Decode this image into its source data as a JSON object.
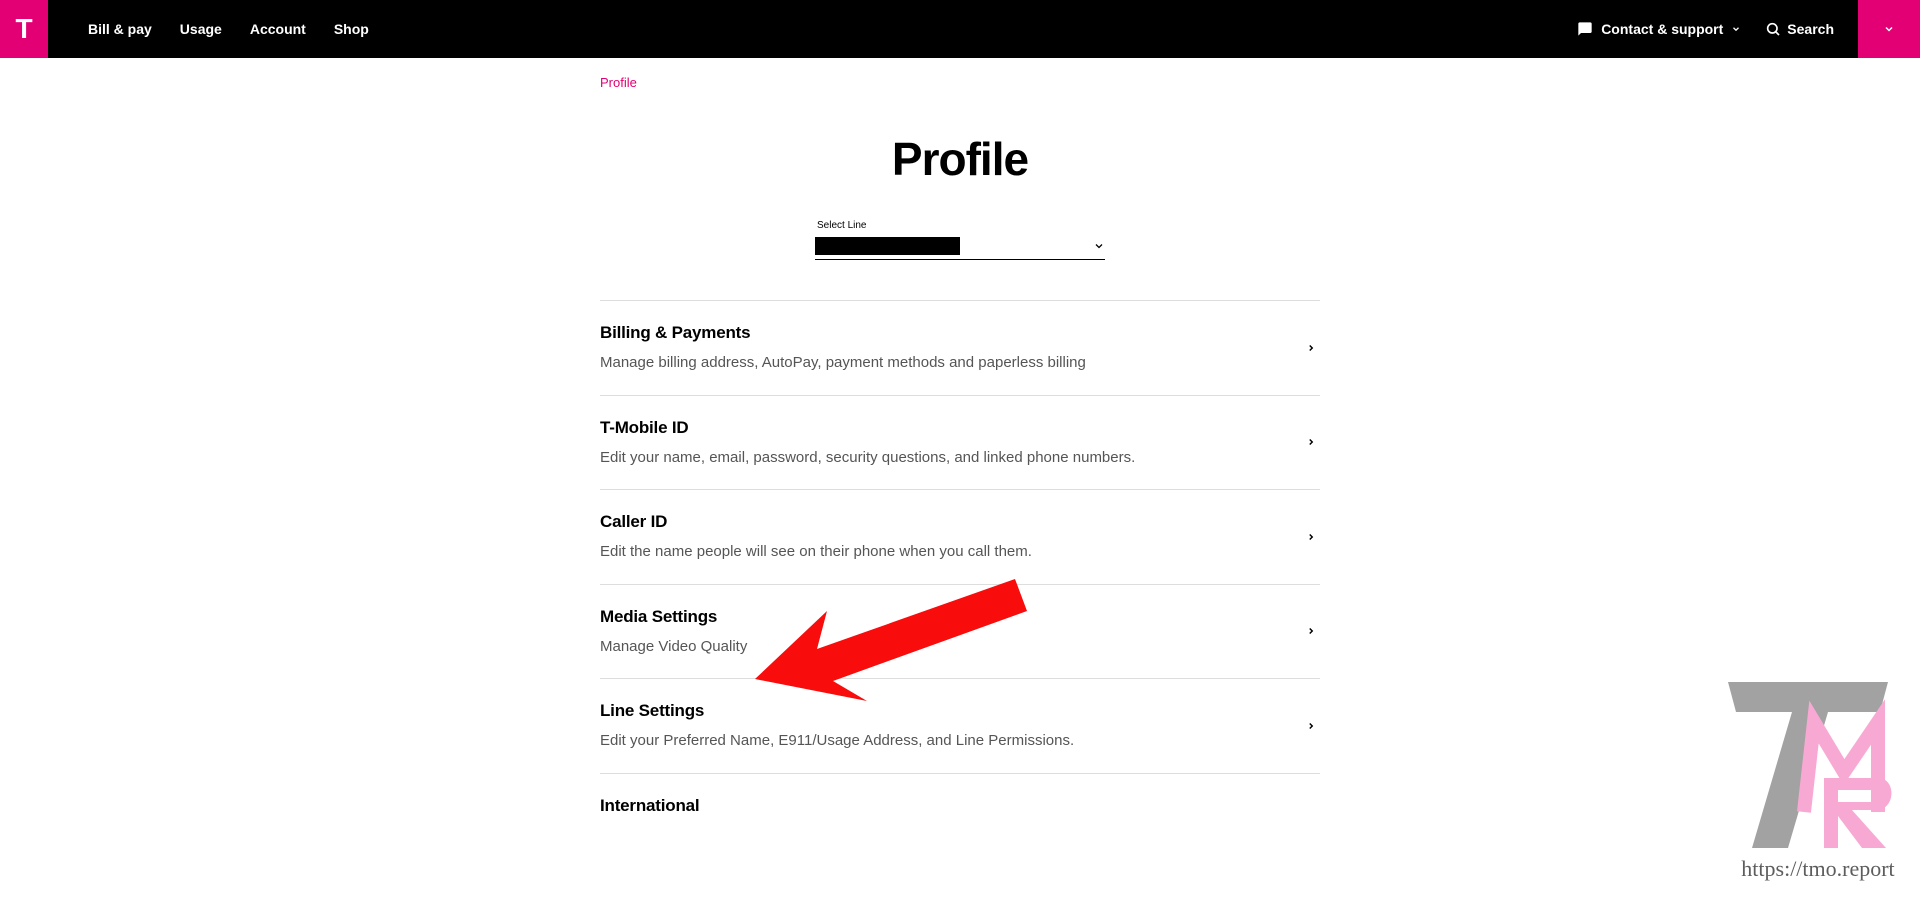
{
  "nav": {
    "links": [
      "Bill & pay",
      "Usage",
      "Account",
      "Shop"
    ],
    "contact_label": "Contact & support",
    "search_label": "Search"
  },
  "breadcrumb": {
    "profile": "Profile"
  },
  "page": {
    "title": "Profile"
  },
  "select": {
    "label": "Select Line"
  },
  "sections": [
    {
      "title": "Billing & Payments",
      "desc": "Manage billing address, AutoPay, payment methods and paperless billing"
    },
    {
      "title": "T-Mobile ID",
      "desc": "Edit your name, email, password, security questions, and linked phone numbers."
    },
    {
      "title": "Caller ID",
      "desc": "Edit the name people will see on their phone when you call them."
    },
    {
      "title": "Media Settings",
      "desc": "Manage Video Quality"
    },
    {
      "title": "Line Settings",
      "desc": "Edit your Preferred Name, E911/Usage Address, and Line Permissions."
    },
    {
      "title": "International",
      "desc": ""
    }
  ],
  "watermark": {
    "url": "https://tmo.report"
  }
}
